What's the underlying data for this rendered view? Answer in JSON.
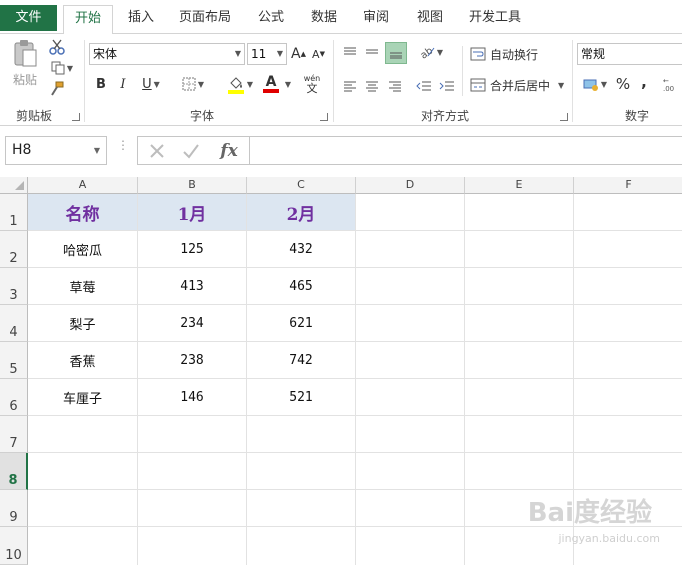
{
  "tabs": {
    "file": "文件",
    "items": [
      "开始",
      "插入",
      "页面布局",
      "公式",
      "数据",
      "审阅",
      "视图",
      "开发工具"
    ]
  },
  "ribbon": {
    "clipboard": {
      "paste_label": "粘贴",
      "group_label": "剪贴板"
    },
    "font": {
      "font_name": "宋体",
      "font_size": "11",
      "bold": "B",
      "italic": "I",
      "underline": "U",
      "phonetic": "wén",
      "phonetic_sub": "文",
      "group_label": "字体",
      "increase_glyph": "A",
      "decrease_glyph": "A",
      "font_color_glyph": "A"
    },
    "alignment": {
      "wrap_text": "自动换行",
      "merge_center": "合并后居中",
      "group_label": "对齐方式"
    },
    "number": {
      "format": "常规",
      "percent": "%",
      "comma": ",",
      "group_label": "数字"
    }
  },
  "formula_bar": {
    "name_box": "H8",
    "fx": "fx",
    "value": ""
  },
  "sheet": {
    "columns": [
      "A",
      "B",
      "C",
      "D",
      "E",
      "F"
    ],
    "rows": [
      "1",
      "2",
      "3",
      "4",
      "5",
      "6",
      "7",
      "8",
      "9",
      "10"
    ],
    "selected_row": "8",
    "header": [
      "名称",
      "1月",
      "2月"
    ],
    "data": [
      [
        "哈密瓜",
        "125",
        "432"
      ],
      [
        "草莓",
        "413",
        "465"
      ],
      [
        "梨子",
        "234",
        "621"
      ],
      [
        "香蕉",
        "238",
        "742"
      ],
      [
        "车厘子",
        "146",
        "521"
      ]
    ]
  },
  "watermark": {
    "brand": "Bai度经验",
    "url": "jingyan.baidu.com"
  },
  "colors": {
    "accent": "#217346",
    "header_fill": "#dce6f1",
    "header_text": "#7030a0",
    "font_color_bar": "#e00000",
    "fill_color_bar": "#ffff00"
  }
}
